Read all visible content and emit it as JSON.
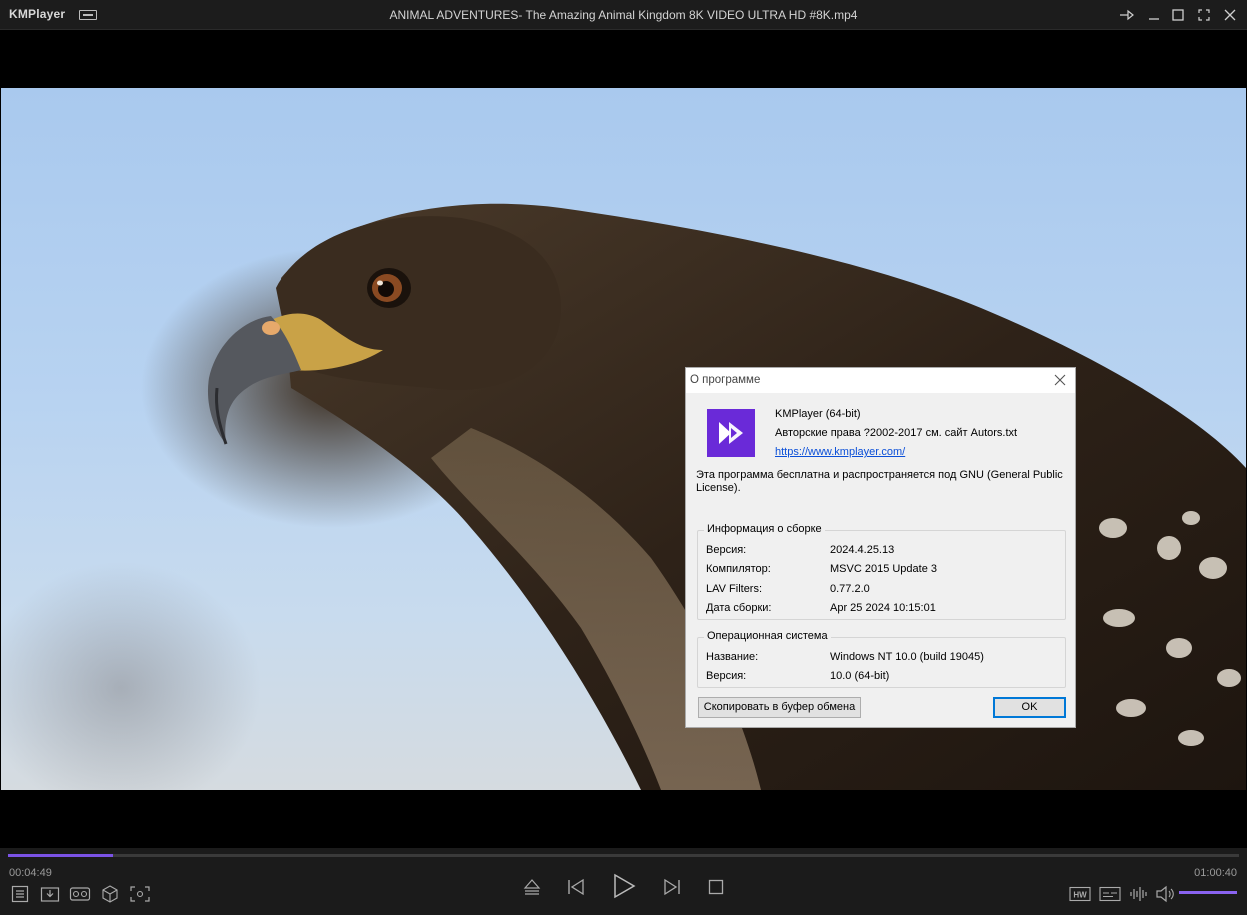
{
  "titlebar": {
    "app_name": "KMPlayer",
    "title": "ANIMAL ADVENTURES- The Amazing Animal Kingdom 8K VIDEO ULTRA HD #8K.mp4",
    "buttons": [
      "pin-icon",
      "minimize-icon",
      "maximize-icon",
      "fullscreen-icon",
      "close-icon"
    ]
  },
  "dialog": {
    "title": "О программе",
    "product": "KMPlayer (64-bit)",
    "copyright": "Авторские права ?2002-2017 см. сайт Autors.txt",
    "link": "https://www.kmplayer.com/",
    "license": "Эта программа бесплатна и распространяется под GNU (General Public License).",
    "build_group": {
      "label": "Информация о сборке",
      "rows": [
        {
          "key": "Версия:",
          "value": "2024.4.25.13"
        },
        {
          "key": "Компилятор:",
          "value": "MSVC 2015 Update 3"
        },
        {
          "key": "LAV Filters:",
          "value": "0.77.2.0"
        },
        {
          "key": "Дата сборки:",
          "value": "Apr 25 2024 10:15:01"
        }
      ]
    },
    "os_group": {
      "label": "Операционная система",
      "rows": [
        {
          "key": "Название:",
          "value": "Windows NT 10.0 (build 19045)"
        },
        {
          "key": "Версия:",
          "value": "10.0 (64-bit)"
        }
      ]
    },
    "copy_button": "Скопировать в буфер обмена",
    "ok_button": "OK"
  },
  "player": {
    "time_current": "00:04:49",
    "time_total": "01:00:40",
    "progress": 0.0854,
    "volume": 1.0,
    "accent_color": "#7b53e6"
  }
}
